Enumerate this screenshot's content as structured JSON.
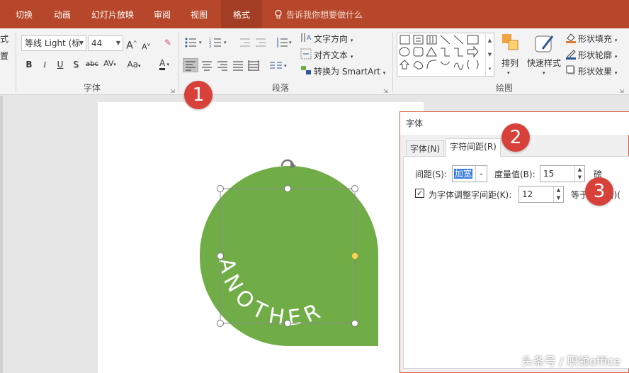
{
  "menubar": {
    "tabs": [
      "切换",
      "动画",
      "幻灯片放映",
      "审阅",
      "视图",
      "格式"
    ],
    "tell_me": "告诉我你想要做什么"
  },
  "ribbon": {
    "font": {
      "font_name": "等线 Light (标",
      "font_size": "44",
      "group_label": "字体",
      "bold": "B",
      "italic": "I",
      "underline": "U",
      "shadow": "S",
      "strike": "abc",
      "spacing": "AV",
      "case": "Aa",
      "color": "A"
    },
    "paragraph": {
      "text_direction": "文字方向",
      "align_text": "对齐文本",
      "convert_smartart": "转换为 SmartArt",
      "group_label": "段落"
    },
    "drawing": {
      "arrange": "排列",
      "quick_styles": "快速样式",
      "shape_fill": "形状填充",
      "shape_outline": "形状轮廓",
      "shape_effects": "形状效果",
      "group_label": "绘图"
    },
    "left_clip": {
      "a": "式",
      "b": "置"
    }
  },
  "slide": {
    "shape_text": "ANOTHER",
    "shape_color": "#70ad47"
  },
  "dialog": {
    "title": "字体",
    "tab_font": "字体(N)",
    "tab_spacing": "字符间距(R)",
    "spacing_label": "间距(S):",
    "spacing_value": "加宽",
    "measure_label": "度量值(B):",
    "measure_value": "15",
    "unit_clipped": "磅",
    "kerning_label": "为字体调整字间距(K):",
    "kerning_value": "12",
    "kerning_after": "等于",
    "kerning_unit": "(磅)("
  },
  "callouts": [
    "1",
    "2",
    "3"
  ],
  "watermark": "头条号 / 职领office"
}
